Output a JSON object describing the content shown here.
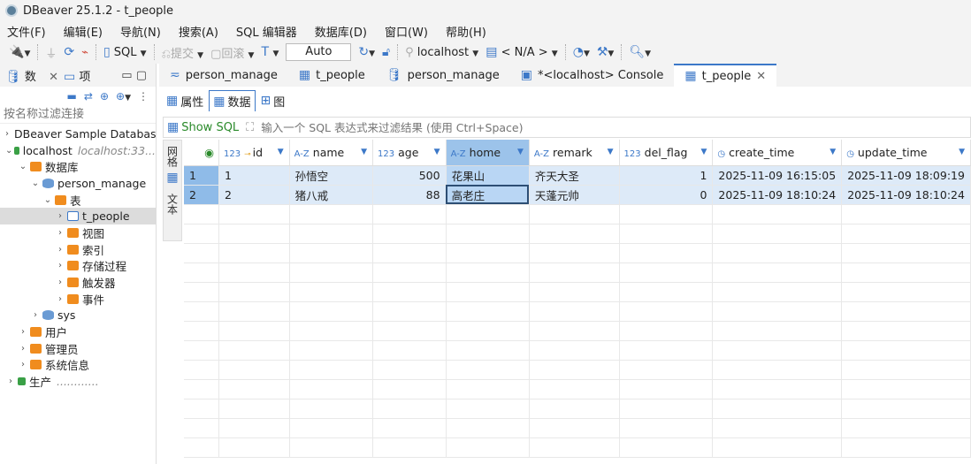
{
  "window": {
    "title": "DBeaver 25.1.2 - t_people"
  },
  "menu": [
    "文件(F)",
    "编辑(E)",
    "导航(N)",
    "搜索(A)",
    "SQL 编辑器",
    "数据库(D)",
    "窗口(W)",
    "帮助(H)"
  ],
  "toolbar": {
    "sql": "SQL",
    "commit": "提交",
    "rollback": "回滚",
    "mode": "Auto",
    "connection": "localhost",
    "schema": "< N/A >"
  },
  "left": {
    "tabs": [
      "数",
      "项"
    ],
    "filter_placeholder": "按名称过滤连接",
    "tree": [
      {
        "label": "DBeaver Sample Databas",
        "depth": 0,
        "arrow": ">",
        "icon": "db"
      },
      {
        "label": "localhost",
        "sub": "localhost:33...",
        "depth": 0,
        "arrow": "v",
        "icon": "conn"
      },
      {
        "label": "数据库",
        "depth": 1,
        "arrow": "v",
        "icon": "folder"
      },
      {
        "label": "person_manage",
        "depth": 2,
        "arrow": "v",
        "icon": "db"
      },
      {
        "label": "表",
        "depth": 3,
        "arrow": "v",
        "icon": "folder"
      },
      {
        "label": "t_people",
        "depth": 4,
        "arrow": ">",
        "icon": "tbl",
        "selected": true
      },
      {
        "label": "视图",
        "depth": 4,
        "arrow": ">",
        "icon": "folder"
      },
      {
        "label": "索引",
        "depth": 4,
        "arrow": ">",
        "icon": "folder"
      },
      {
        "label": "存储过程",
        "depth": 4,
        "arrow": ">",
        "icon": "folder"
      },
      {
        "label": "触发器",
        "depth": 4,
        "arrow": ">",
        "icon": "folder"
      },
      {
        "label": "事件",
        "depth": 4,
        "arrow": ">",
        "icon": "folder"
      },
      {
        "label": "sys",
        "depth": 2,
        "arrow": ">",
        "icon": "db"
      },
      {
        "label": "用户",
        "depth": 1,
        "arrow": ">",
        "icon": "folder"
      },
      {
        "label": "管理员",
        "depth": 1,
        "arrow": ">",
        "icon": "folder"
      },
      {
        "label": "系统信息",
        "depth": 1,
        "arrow": ">",
        "icon": "folder"
      },
      {
        "label": "生产",
        "sub": "............",
        "depth": 0,
        "arrow": ">",
        "icon": "conn"
      }
    ]
  },
  "editor_tabs": [
    "person_manage",
    "t_people",
    "person_manage",
    "*<localhost> Console",
    "t_people"
  ],
  "sub_tabs": [
    "属性",
    "数据",
    "图"
  ],
  "filter": {
    "show_sql": "Show SQL",
    "placeholder": "输入一个 SQL 表达式来过滤结果 (使用 Ctrl+Space)"
  },
  "side_labels": [
    "网格",
    "文本"
  ],
  "grid": {
    "columns": [
      {
        "name": "id",
        "type": "123"
      },
      {
        "name": "name",
        "type": "A-Z"
      },
      {
        "name": "age",
        "type": "123"
      },
      {
        "name": "home",
        "type": "A-Z"
      },
      {
        "name": "remark",
        "type": "A-Z"
      },
      {
        "name": "del_flag",
        "type": "123"
      },
      {
        "name": "create_time",
        "type": "◷"
      },
      {
        "name": "update_time",
        "type": "◷"
      }
    ],
    "rows": [
      [
        "1",
        "1",
        "孙悟空",
        "500",
        "花果山",
        "齐天大圣",
        "1",
        "2025-11-09 16:15:05",
        "2025-11-09 18:09:19"
      ],
      [
        "2",
        "2",
        "猪八戒",
        "88",
        "高老庄",
        "天蓬元帅",
        "0",
        "2025-11-09 18:10:24",
        "2025-11-09 18:10:24"
      ]
    ]
  }
}
